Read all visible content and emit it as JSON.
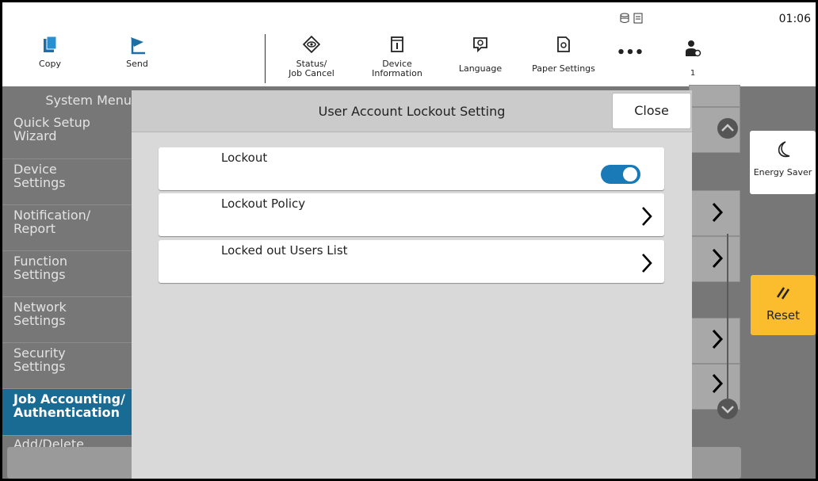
{
  "topbar": {
    "clock": "01:06",
    "status_icons": "⛁⛁",
    "copy_label": "Copy",
    "send_label": "Send",
    "status_label": "Status/\nJob Cancel",
    "device_info_label": "Device\nInformation",
    "language_label": "Language",
    "paper_settings_label": "Paper Settings",
    "more_label": "•••",
    "user_count": "1"
  },
  "sidebar": {
    "title": "System Menu",
    "items": [
      {
        "label": "Quick Setup\nWizard"
      },
      {
        "label": "Device\nSettings"
      },
      {
        "label": "Notification/\nReport"
      },
      {
        "label": "Function\nSettings"
      },
      {
        "label": "Network\nSettings"
      },
      {
        "label": "Security\nSettings"
      },
      {
        "label": "Job Accounting/\nAuthentication"
      },
      {
        "label": "Add/Delete"
      }
    ]
  },
  "right_panel": {
    "energy_saver_label": "Energy Saver",
    "reset_label": "Reset"
  },
  "dialog": {
    "title": "User Account Lockout Setting",
    "close_label": "Close",
    "rows": [
      {
        "label": "Lockout",
        "control": "toggle",
        "value": true
      },
      {
        "label": "Lockout Policy",
        "control": "chevron"
      },
      {
        "label": "Locked out Users List",
        "control": "chevron"
      }
    ]
  },
  "colors": {
    "accent": "#1a7ab8",
    "active_nav": "#1a6b94",
    "reset": "#fbbd2d"
  }
}
